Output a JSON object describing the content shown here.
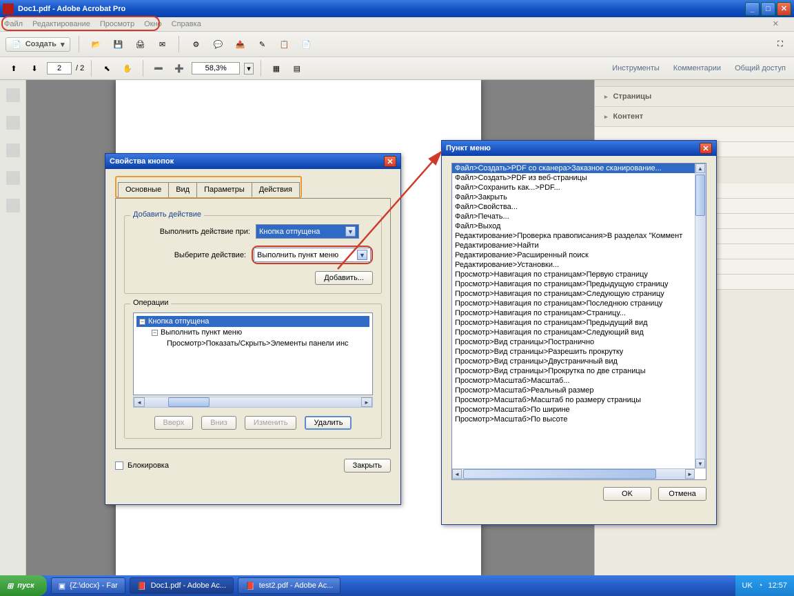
{
  "window": {
    "title": "Doc1.pdf - Adobe Acrobat Pro"
  },
  "menu": {
    "file": "Файл",
    "edit": "Редактирование",
    "view": "Просмотр",
    "window": "Окно",
    "help": "Справка"
  },
  "toolbar": {
    "create": "Создать"
  },
  "nav": {
    "page": "2",
    "pages": "/  2",
    "zoom": "58,3%"
  },
  "rightlinks": {
    "tools": "Инструменты",
    "comments": "Комментарии",
    "share": "Общий доступ"
  },
  "rightpanel": {
    "pages": "Страницы",
    "content": "Контент"
  },
  "dlg1": {
    "title": "Свойства кнопок",
    "tab_main": "Основные",
    "tab_view": "Вид",
    "tab_params": "Параметры",
    "tab_actions": "Действия",
    "grp_add": "Добавить действие",
    "lbl_trigger": "Выполнить действие при:",
    "trigger_val": "Кнопка отпущена",
    "lbl_action": "Выберите действие:",
    "action_val": "Выполнить пункт меню",
    "add_btn": "Добавить...",
    "grp_ops": "Операции",
    "tree_1": "Кнопка отпущена",
    "tree_2": "Выполнить пункт меню",
    "tree_3": "Просмотр>Показать/Скрыть>Элементы панели инс",
    "up": "Вверх",
    "down": "Вниз",
    "edit": "Изменить",
    "delete": "Удалить",
    "lock": "Блокировка",
    "close": "Закрыть"
  },
  "dlg2": {
    "title": "Пункт меню",
    "ok": "OK",
    "cancel": "Отмена",
    "items": [
      "Файл>Создать>PDF со сканера>Заказное сканирование...",
      "Файл>Создать>PDF из веб-страницы",
      "Файл>Сохранить как...>PDF...",
      "Файл>Закрыть",
      "Файл>Свойства...",
      "Файл>Печать...",
      "Файл>Выход",
      "Редактирование>Проверка правописания>В разделах \"Коммент",
      "Редактирование>Найти",
      "Редактирование>Расширенный поиск",
      "Редактирование>Установки...",
      "Просмотр>Навигация по страницам>Первую страницу",
      "Просмотр>Навигация по страницам>Предыдущую страницу",
      "Просмотр>Навигация по страницам>Следующую страницу",
      "Просмотр>Навигация по страницам>Последнюю страницу",
      "Просмотр>Навигация по страницам>Страницу...",
      "Просмотр>Навигация по страницам>Предыдущий вид",
      "Просмотр>Навигация по страницам>Следующий вид",
      "Просмотр>Вид страницы>Постранично",
      "Просмотр>Вид страницы>Разрешить прокрутку",
      "Просмотр>Вид страницы>Двустраничный вид",
      "Просмотр>Вид страницы>Прокрутка по две страницы",
      "Просмотр>Масштаб>Масштаб...",
      "Просмотр>Масштаб>Реальный размер",
      "Просмотр>Масштаб>Масштаб по размеру страницы",
      "Просмотр>Масштаб>По ширине",
      "Просмотр>Масштаб>По высоте"
    ],
    "selected": 0
  },
  "taskbar": {
    "start": "пуск",
    "items": [
      "{Z:\\docx} - Far",
      "Doc1.pdf - Adobe Ac...",
      "test2.pdf - Adobe Ac..."
    ],
    "lang": "UK",
    "time": "12:57"
  }
}
